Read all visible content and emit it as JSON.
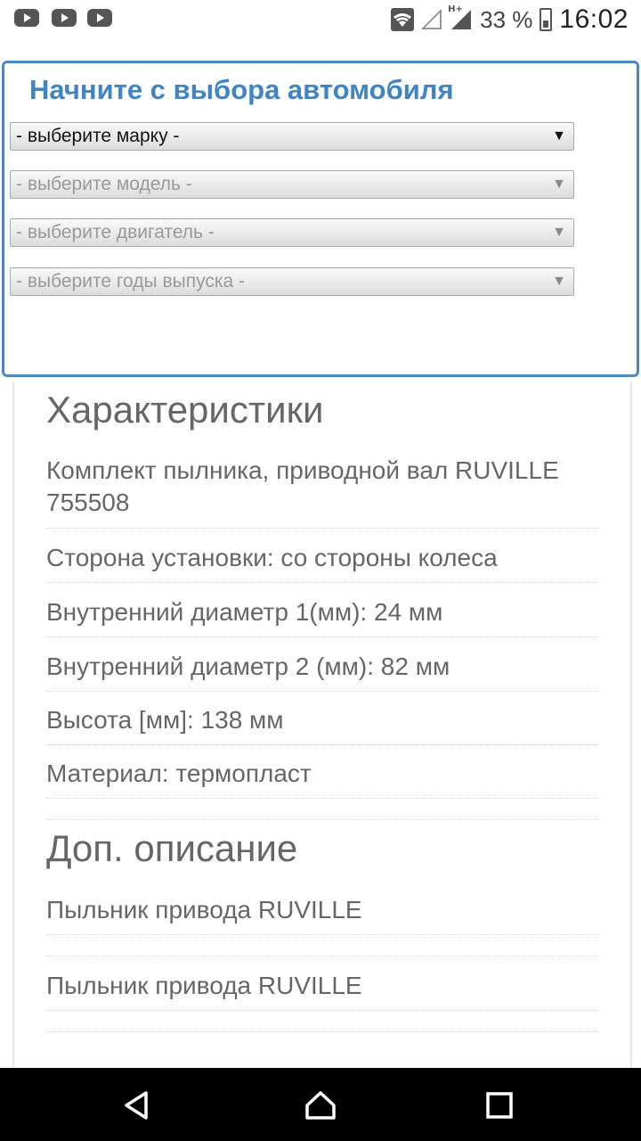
{
  "status_bar": {
    "network_type": "H+",
    "battery_percent": "33 %",
    "time": "16:02",
    "icons": [
      "youtube-icon",
      "youtube-icon",
      "youtube-icon",
      "wifi-icon",
      "signal-empty-icon",
      "signal-icon",
      "battery-icon"
    ]
  },
  "selector": {
    "title": "Начните с выбора автомобиля",
    "dropdowns": [
      {
        "value": "- выберите марку -",
        "enabled": true
      },
      {
        "value": "- выберите модель -",
        "enabled": false
      },
      {
        "value": "- выберите двигатель -",
        "enabled": false
      },
      {
        "value": "- выберите годы выпуска -",
        "enabled": false
      }
    ],
    "arrow": "▼"
  },
  "characteristics": {
    "heading": "Характеристики",
    "items": [
      "Комплект пылника, приводной вал RUVILLE 755508",
      "Сторона установки: со стороны колеса",
      "Внутренний диаметр 1(мм): 24 мм",
      "Внутренний диаметр 2 (мм): 82 мм",
      "Высота [мм]: 138 мм",
      "Материал: термопласт"
    ]
  },
  "description": {
    "heading": "Доп. описание",
    "items": [
      "Пыльник привода RUVILLE",
      "Пыльник привода RUVILLE"
    ]
  },
  "nav_bar": {
    "icons": [
      "back-icon",
      "home-icon",
      "recents-icon"
    ]
  },
  "colors": {
    "accent": "#3f84c4",
    "panel_border": "#4a8ac4",
    "text": "#666666"
  }
}
